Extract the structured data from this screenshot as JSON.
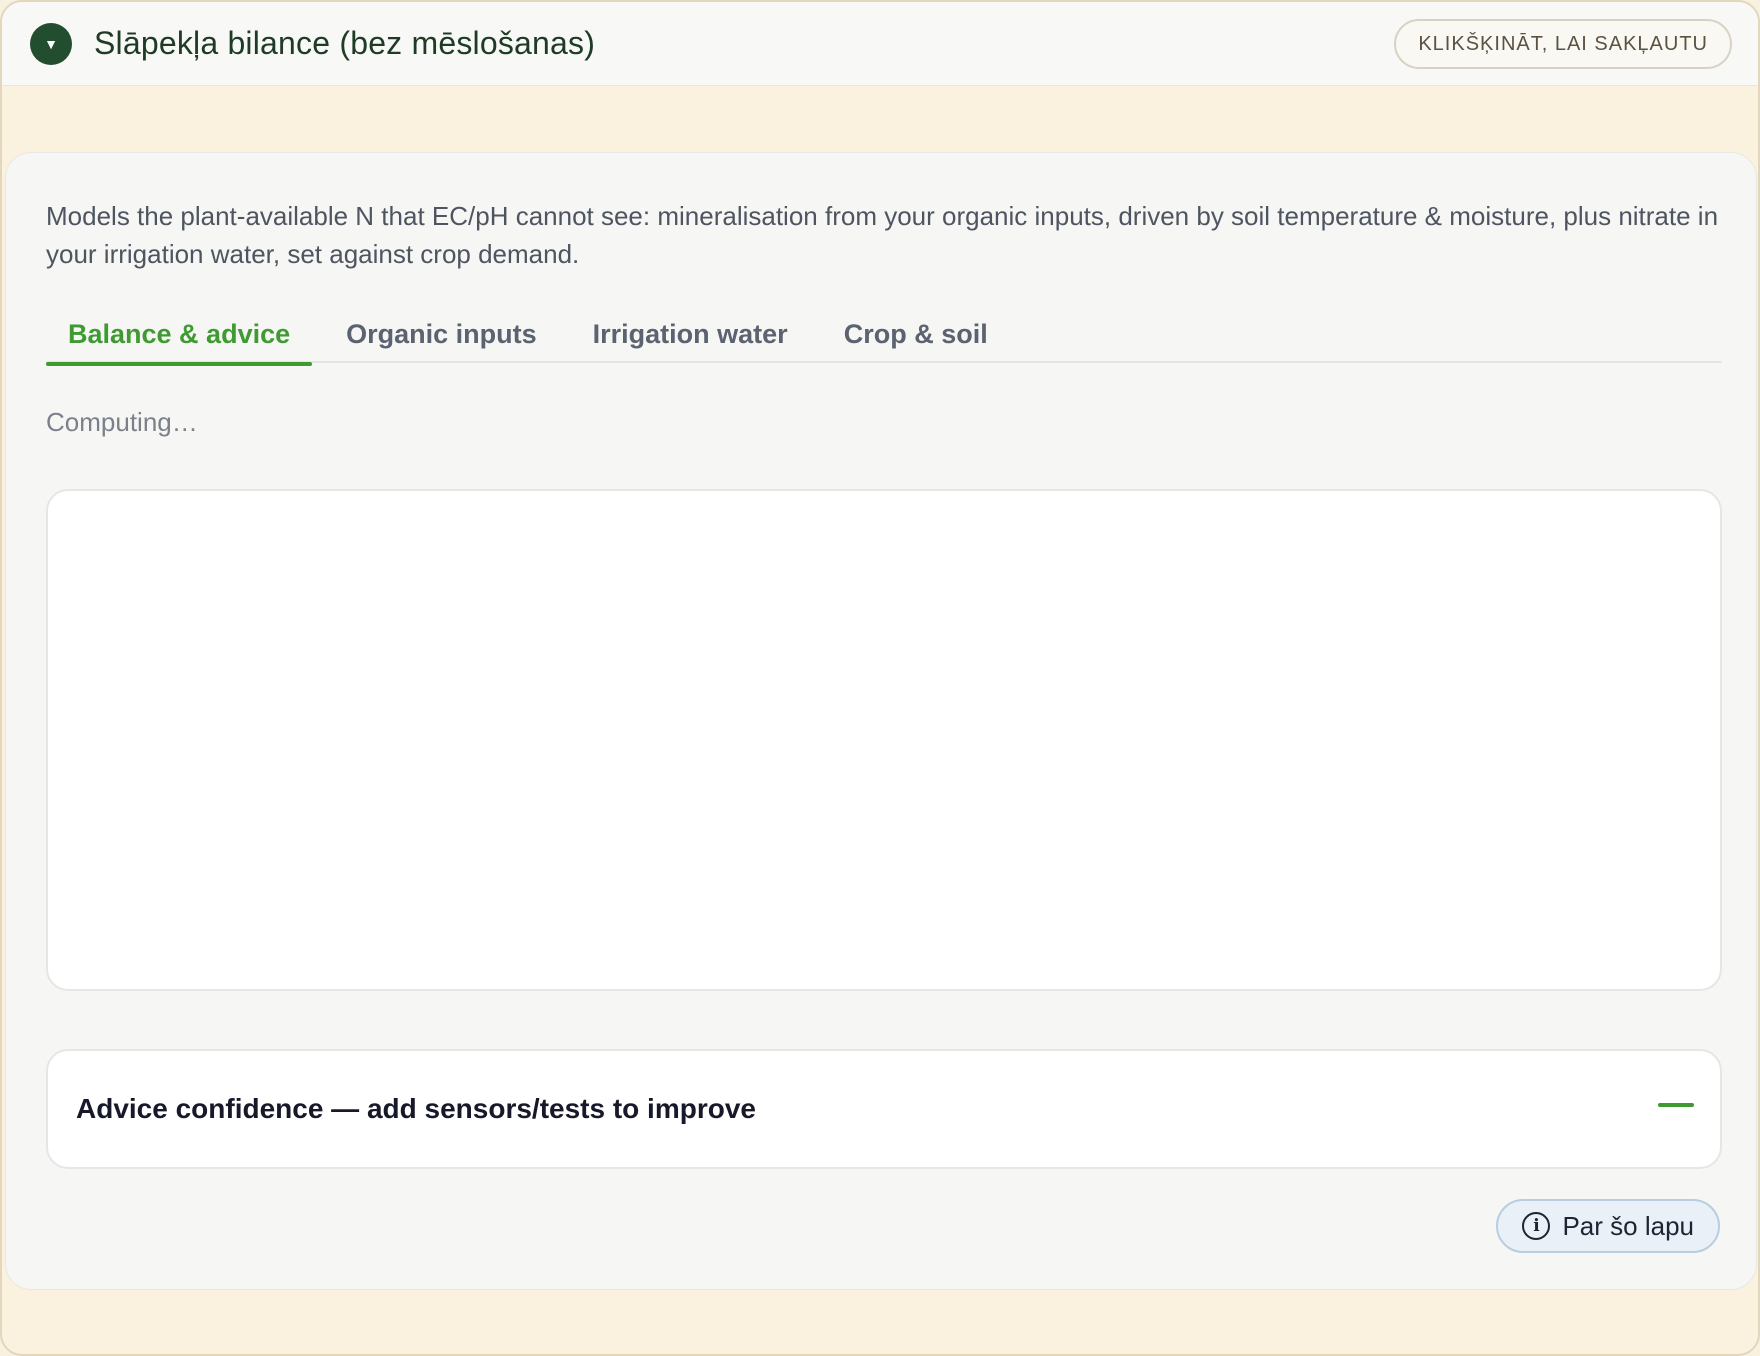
{
  "header": {
    "toggle_icon": "▼",
    "title": "Slāpekļa bilance (bez mēslošanas)",
    "collapse_label": "KLIKŠĶINĀT, LAI SAKĻAUTU"
  },
  "intro": "Models the plant-available N that EC/pH cannot see: mineralisation from your organic inputs, driven by soil temperature & moisture, plus nitrate in your irrigation water, set against crop demand.",
  "tabs": [
    {
      "label": "Balance & advice",
      "active": true
    },
    {
      "label": "Organic inputs",
      "active": false
    },
    {
      "label": "Irrigation water",
      "active": false
    },
    {
      "label": "Crop & soil",
      "active": false
    }
  ],
  "status": "Computing…",
  "confidence": {
    "title": "Advice confidence — add sensors/tests to improve"
  },
  "about": {
    "icon": "i",
    "label": "Par šo lapu"
  },
  "colors": {
    "accent": "#3e9a31",
    "header_dark": "#234d2f",
    "background": "#faf1df"
  }
}
